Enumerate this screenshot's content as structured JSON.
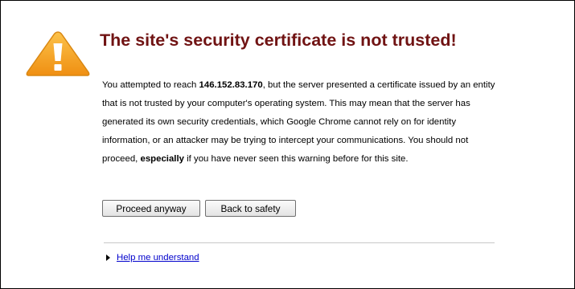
{
  "icon": {
    "name": "warning-icon",
    "color": "#f5a623"
  },
  "title": "The site's security certificate is not trusted!",
  "message": {
    "part1": "You attempted to reach ",
    "host": "146.152.83.170",
    "part2": ", but the server presented a certificate issued by an entity that is not trusted by your computer's operating system. This may mean that the server has generated its own security credentials, which Google Chrome cannot rely on for identity information, or an attacker may be trying to intercept your communications. You should not proceed, ",
    "emphasis": "especially",
    "part3": " if you have never seen this warning before for this site."
  },
  "buttons": {
    "proceed_label": "Proceed anyway",
    "back_label": "Back to safety"
  },
  "help": {
    "link_label": "Help me understand"
  },
  "colors": {
    "title": "#701313",
    "link": "#0000cc"
  }
}
